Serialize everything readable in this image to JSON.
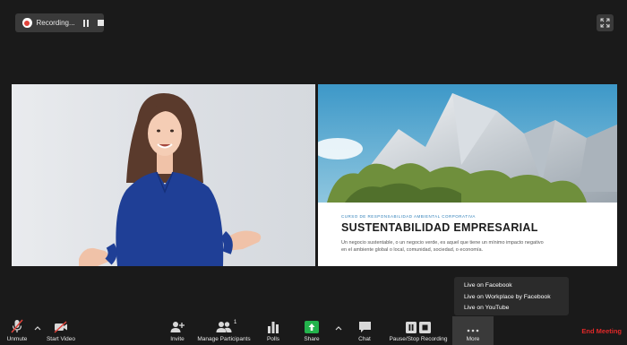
{
  "recording": {
    "label": "Recording..."
  },
  "slide": {
    "kicker": "CURSO DE RESPONSABILIDAD AMBIENTAL CORPORATIVA",
    "title": "SUSTENTABILIDAD EMPRESARIAL",
    "body": "Un negocio sustentable, o un negocio verde, es aquel que tiene un mínimo impacto negativo en el ambiente global o local, comunidad, sociedad, o economía."
  },
  "more_menu": {
    "items": [
      "Live on Facebook",
      "Live on Workplace by Facebook",
      "Live on YouTube"
    ]
  },
  "toolbar": {
    "unmute": "Unmute",
    "start_video": "Start Video",
    "invite": "Invite",
    "manage_participants": "Manage Participants",
    "participants_count": "1",
    "polls": "Polls",
    "share": "Share",
    "chat": "Chat",
    "pause_stop_recording": "Pause/Stop Recording",
    "more": "More",
    "end_meeting": "End Meeting"
  },
  "colors": {
    "background": "#1a1a1a",
    "end_meeting": "#e02828",
    "share_green": "#23b34c",
    "record_red": "#e0423a",
    "slide_accent": "#2f7fb8"
  }
}
